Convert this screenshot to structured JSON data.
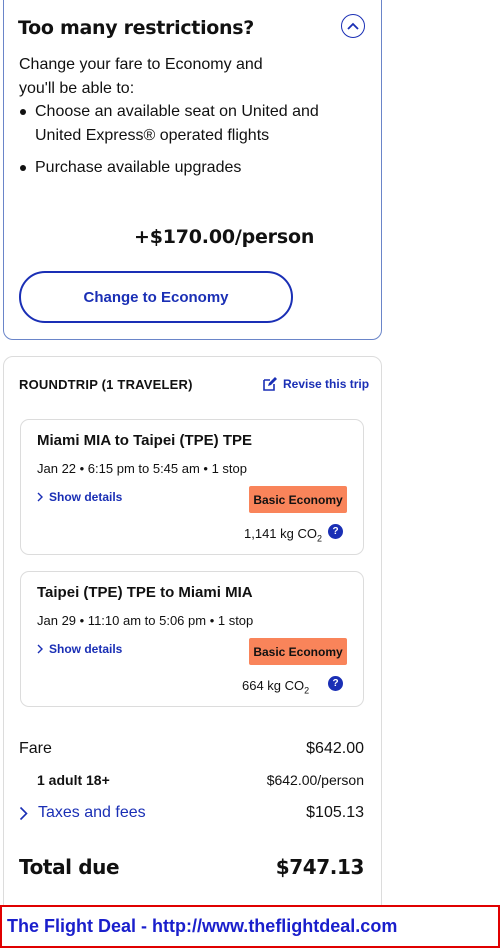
{
  "restrictions": {
    "title": "Too many restrictions?",
    "intro": "Change your fare to Economy and you'll be able to:",
    "bullets": [
      "Choose an available seat on United and United Express® operated flights",
      "Purchase available upgrades"
    ],
    "price_delta": "+$170.00/person",
    "change_button": "Change to Economy"
  },
  "trip": {
    "heading": "ROUNDTRIP (1 TRAVELER)",
    "revise_label": "Revise this trip",
    "flights": [
      {
        "route": "Miami MIA to Taipei (TPE) TPE",
        "time": "Jan 22 • 6:15 pm to 5:45 am • 1 stop",
        "details_label": "Show details",
        "badge": "Basic Economy",
        "co2_value": "1,141 kg CO",
        "co2_sub": "2"
      },
      {
        "route": "Taipei (TPE) TPE to Miami MIA",
        "time": "Jan 29 • 11:10 am to 5:06 pm • 1 stop",
        "details_label": "Show details",
        "badge": "Basic Economy",
        "co2_value": "664 kg CO",
        "co2_sub": "2"
      }
    ]
  },
  "pricing": {
    "fare_label": "Fare",
    "fare_value": "$642.00",
    "adult_label": "1 adult 18+",
    "adult_value": "$642.00/person",
    "taxes_label": "Taxes and fees",
    "taxes_value": "$105.13",
    "total_label": "Total due",
    "total_value": "$747.13"
  },
  "watermark": "The Flight Deal - http://www.theflightdeal.com",
  "colors": {
    "accent": "#1a2fb5",
    "badge": "#f9845a",
    "watermark_border": "#e00000",
    "watermark_text": "#1a1fcc"
  }
}
